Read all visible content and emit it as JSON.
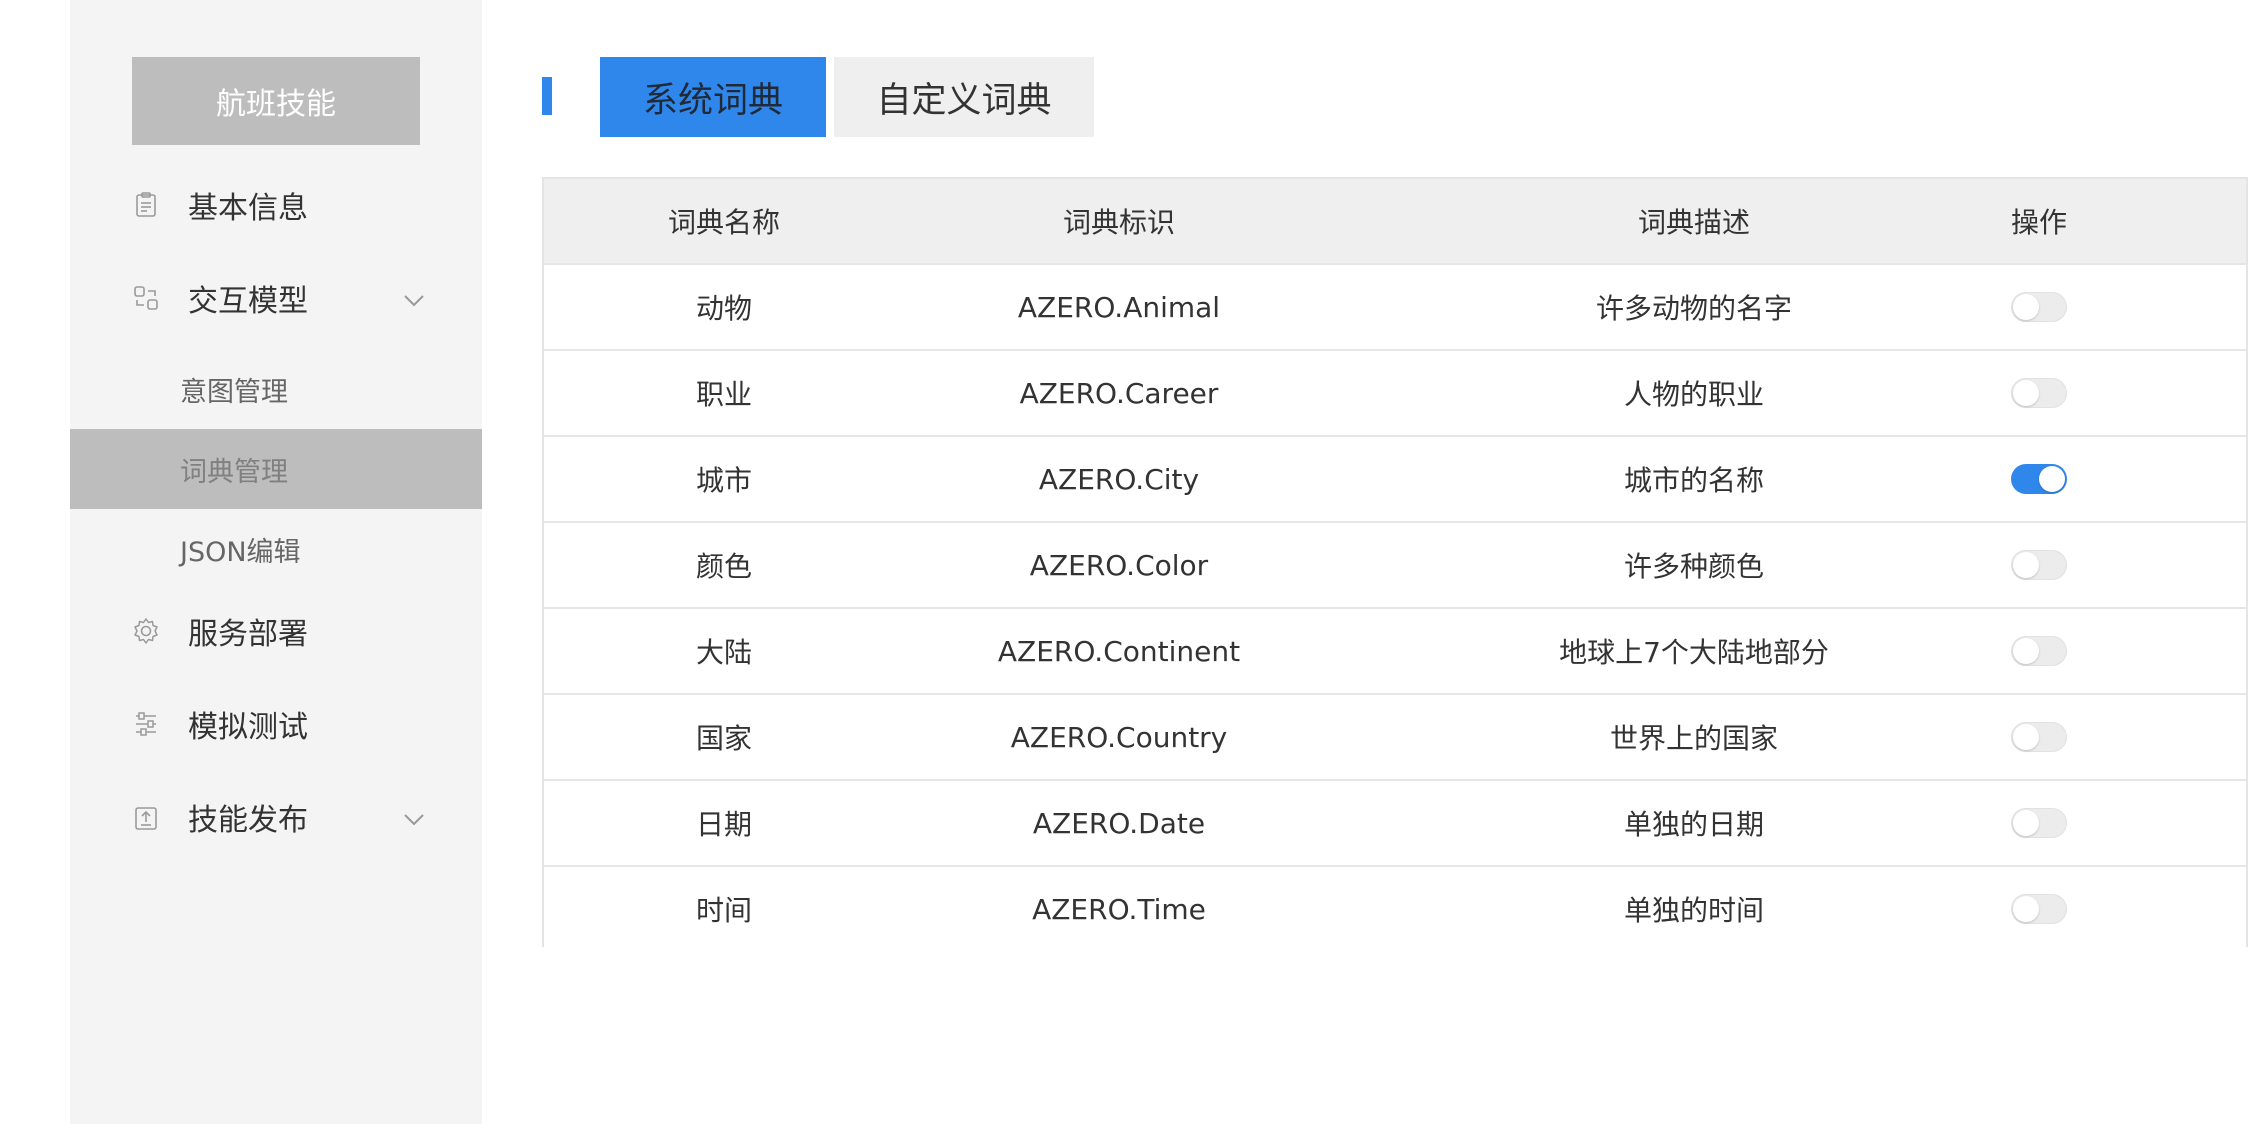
{
  "sidebar": {
    "skill_title": "航班技能",
    "menu": {
      "basic_info": "基本信息",
      "interaction_model": "交互模型",
      "service_deploy": "服务部署",
      "simulation_test": "模拟测试",
      "skill_publish": "技能发布"
    },
    "submenu": {
      "intent_manage": "意图管理",
      "dict_manage": "词典管理",
      "json_edit": "JSON编辑"
    },
    "active_submenu": "词典管理"
  },
  "tabs": {
    "system": "系统词典",
    "custom": "自定义词典",
    "active": "系统词典"
  },
  "table": {
    "headers": {
      "name": "词典名称",
      "id": "词典标识",
      "desc": "词典描述",
      "op": "操作"
    },
    "rows": [
      {
        "name": "动物",
        "id": "AZERO.Animal",
        "desc": "许多动物的名字",
        "enabled": false
      },
      {
        "name": "职业",
        "id": "AZERO.Career",
        "desc": "人物的职业",
        "enabled": false
      },
      {
        "name": "城市",
        "id": "AZERO.City",
        "desc": "城市的名称",
        "enabled": true
      },
      {
        "name": "颜色",
        "id": "AZERO.Color",
        "desc": "许多种颜色",
        "enabled": false
      },
      {
        "name": "大陆",
        "id": "AZERO.Continent",
        "desc": "地球上7个大陆地部分",
        "enabled": false
      },
      {
        "name": "国家",
        "id": "AZERO.Country",
        "desc": "世界上的国家",
        "enabled": false
      },
      {
        "name": "日期",
        "id": "AZERO.Date",
        "desc": "单独的日期",
        "enabled": false
      },
      {
        "name": "时间",
        "id": "AZERO.Time",
        "desc": "单独的时间",
        "enabled": false
      }
    ]
  },
  "colors": {
    "accent": "#2f87ec",
    "sidebar_bg": "#f4f4f4",
    "active_bg": "#bdbdbd",
    "header_bg": "#efefef"
  },
  "icons": {
    "basic_info": "clipboard-icon",
    "interaction_model": "flow-icon",
    "service_deploy": "gear-icon",
    "simulation_test": "sliders-icon",
    "skill_publish": "upload-icon"
  }
}
